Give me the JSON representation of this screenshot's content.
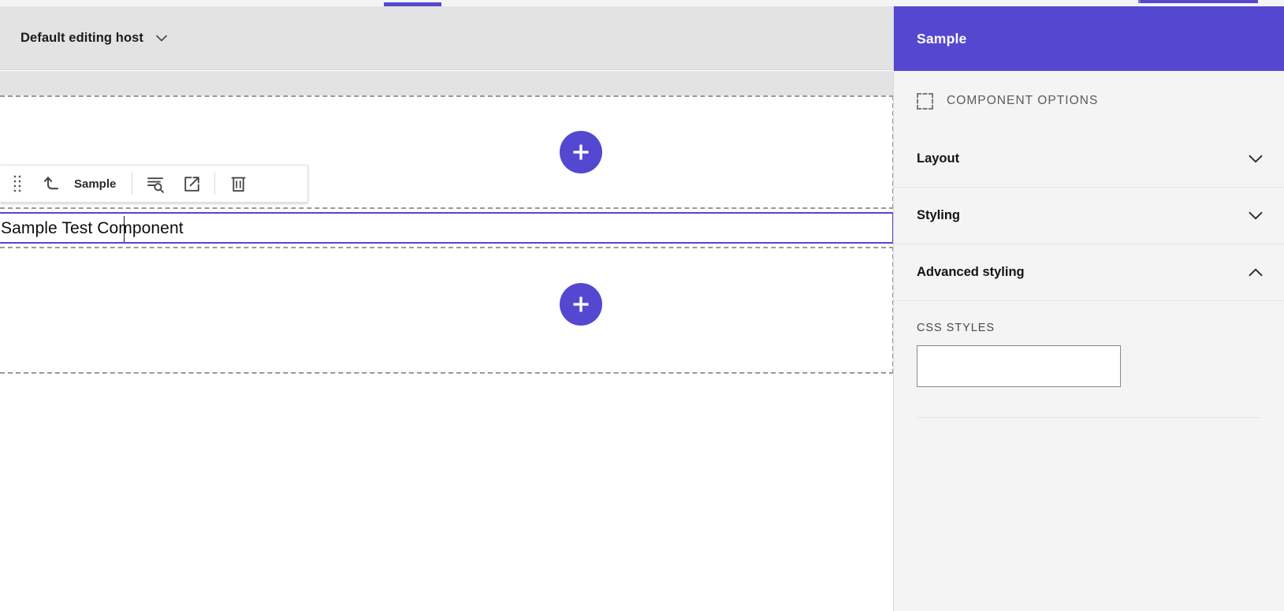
{
  "accent_color": "#5448d0",
  "top_bar": {
    "tab_indicator_left": "active-tab-underline",
    "tab_indicator_right": "active-tab-underline"
  },
  "host_bar": {
    "editing_host_label": "Default editing host",
    "dropdown_icon": "chevron-down-icon"
  },
  "canvas": {
    "add_button_top_label": "+",
    "add_button_bottom_label": "+",
    "selected_component_text": "Sample Test Component",
    "placeholder_zone_top": "empty-placeholder",
    "placeholder_zone_bottom": "empty-placeholder"
  },
  "component_toolbar": {
    "drag_handle_icon": "drag-handle-icon",
    "go_to_parent_icon": "go-to-parent-arrow-icon",
    "component_name": "Sample",
    "details_icon": "list-search-icon",
    "open_in_new_icon": "open-in-new-window-icon",
    "delete_icon": "trash-icon"
  },
  "panel": {
    "title": "Sample",
    "options_header": {
      "icon": "dashed-square-icon",
      "label": "COMPONENT OPTIONS"
    },
    "accordions": [
      {
        "label": "Layout",
        "icon": "chevron-down-icon",
        "expanded": false
      },
      {
        "label": "Styling",
        "icon": "chevron-down-icon",
        "expanded": false
      },
      {
        "label": "Advanced styling",
        "icon": "chevron-up-icon",
        "expanded": true
      }
    ],
    "css_styles": {
      "label": "CSS STYLES",
      "value": "",
      "placeholder": ""
    }
  }
}
